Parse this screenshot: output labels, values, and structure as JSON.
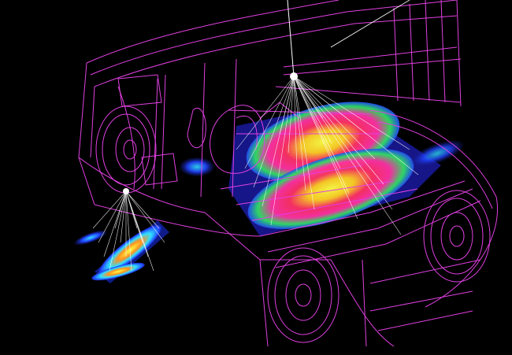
{
  "scene": {
    "background": "#000000",
    "wireframe_color": "#e040e0",
    "ray_color": "#ffffff",
    "heat_colors": [
      "#1010a0",
      "#2030ff",
      "#20d0ff",
      "#30ff60",
      "#ffff30",
      "#ff9020",
      "#ff2040"
    ],
    "statusbar_color": "#2a2a2a",
    "subject": "vehicle-wireframe",
    "light_sources": 2
  }
}
